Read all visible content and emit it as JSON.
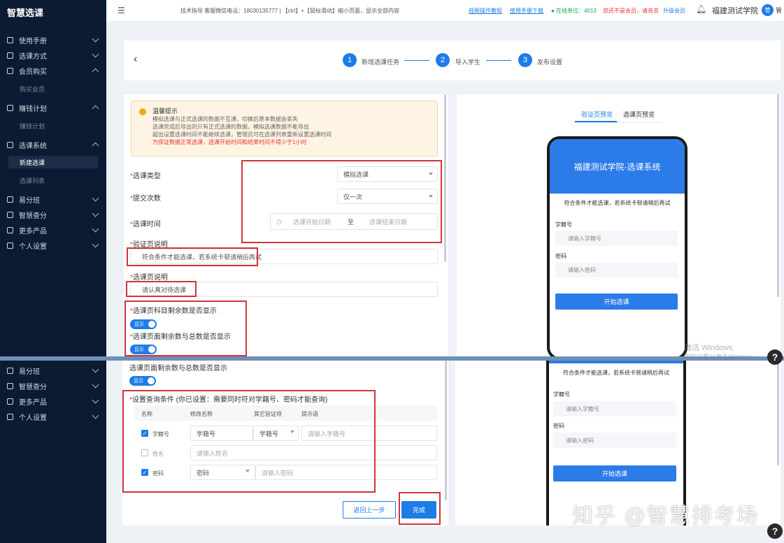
{
  "brand": "智慧选课",
  "topbar": {
    "menu_icon": "menu-fold-icon",
    "support_text": "技术指导 客服微信电话：18030135777 | 【ctrl】+【鼠标滑动】缩小页面，显示全部内容",
    "link_video": "视频操作教程",
    "link_manual": "使用手册下载",
    "online_units": "● 在线单位：4013",
    "vip_notice": "您还不是会员，请充去",
    "upgrade": "升级会员",
    "bell_icon": "bell-icon",
    "school": "福建测试学院",
    "avatar_text": "管",
    "user_short": "管"
  },
  "sidebar": {
    "items": [
      {
        "label": "使用手册"
      },
      {
        "label": "选课方式"
      },
      {
        "label": "会员购买"
      },
      {
        "label": "购买会员"
      },
      {
        "label": "赚钱计划"
      },
      {
        "label": "赚钱计划"
      },
      {
        "label": "选课系统"
      },
      {
        "label": "新建选课"
      },
      {
        "label": "选课列表"
      },
      {
        "label": "易分班"
      },
      {
        "label": "智慧查分"
      },
      {
        "label": "更多产品"
      },
      {
        "label": "个人设置"
      }
    ],
    "lower_items": [
      {
        "label": "易分班"
      },
      {
        "label": "智慧查分"
      },
      {
        "label": "更多产品"
      },
      {
        "label": "个人设置"
      }
    ]
  },
  "steps": [
    {
      "num": "1",
      "label": "新增选课任务"
    },
    {
      "num": "2",
      "label": "导入学生"
    },
    {
      "num": "3",
      "label": "发布设置"
    }
  ],
  "notice": {
    "title": "温馨提示",
    "lines": [
      "模拟选课与正式选课的数据不互通，切换后原本数据会丢失",
      "选课完成后导出的只有正式选课的数据，模拟选课数据不能导出",
      "超出设置选课时间不能继续选课，管理员可在选课列表重新设置选课时间"
    ],
    "warning": "为保证数据正常选课，选课开始时间和结束时间不得少于1小时"
  },
  "form": {
    "type_label": "选课类型",
    "type_value": "模拟选课",
    "submit_label": "提交次数",
    "submit_value": "仅一次",
    "time_label": "选课时间",
    "time_start": "选课开始日期",
    "time_sep": "至",
    "time_end": "选课结束日期",
    "verify_label": "验证页说明",
    "verify_value": "符合条件才能选课，若系统卡顿请稍后再试",
    "select_label": "选课页说明",
    "select_value": "请认真对待选课",
    "remain_label": "选课页科目剩余数是否显示",
    "remain_toggle": "显示",
    "total_label": "选课页面剩余数与总数是否显示",
    "total_toggle": "显示"
  },
  "lower_form": {
    "total_label": "选课页面剩余数与总数是否显示",
    "total_toggle": "显示",
    "query_label": "设置查询条件 (你已设置：需要同时符对学籍号、密码才能查询)",
    "headers": [
      "名称",
      "修改名称",
      "其它验证项",
      "提示语"
    ],
    "rows": [
      {
        "checked": true,
        "name": "学籍号",
        "rename": "学籍号",
        "other": "学籍号",
        "hint": "请输入学籍号"
      },
      {
        "checked": false,
        "name": "姓名",
        "rename": "请输入姓名",
        "other": "",
        "hint": ""
      },
      {
        "checked": true,
        "name": "密码",
        "rename": "密码",
        "other": "",
        "hint": "请输入密码"
      }
    ],
    "back_button": "返回上一步",
    "finish_button": "完成"
  },
  "preview": {
    "tabs": [
      "验证页预览",
      "选课页预览"
    ],
    "phone_title": "福建测试学院-选课系统",
    "phone_notice": "符合条件才能选课，若系统卡顿请稍后再试",
    "field1_label": "学籍号",
    "field1_ph": "请输入学籍号",
    "field2_label": "密码",
    "field2_ph": "请输入密码",
    "start_button": "开始选课"
  },
  "overlays": {
    "activate1": "激活 Windows",
    "activate2": "转到\"设置\"以激活 Windows。",
    "zhihu_wm": "知乎 @智慧排考场",
    "help": "?"
  },
  "colors": {
    "accent": "#1e7ce8",
    "sidebar_bg": "#0c1b33",
    "highlight_red": "#d0343d"
  }
}
